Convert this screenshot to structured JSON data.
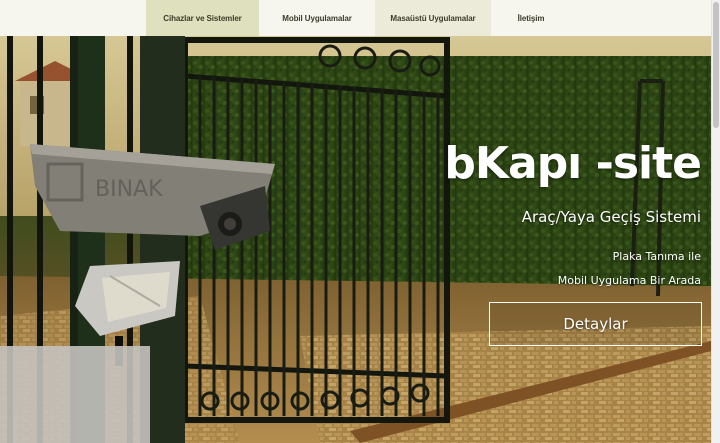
{
  "nav": {
    "items": [
      {
        "label": "Cihazlar ve Sistemler",
        "active": true
      },
      {
        "label": "Mobil Uygulamalar"
      },
      {
        "label": "Masaüstü Uygulamalar"
      },
      {
        "label": "İletişim"
      }
    ]
  },
  "hero": {
    "title": "bKapı -site",
    "subtitle": "Araç/Yaya Geçiş Sistemi",
    "line1": "Plaka Tanıma ile",
    "line2": "Mobil Uygulama Bir Arada",
    "button_label": "Detaylar",
    "camera_brand": "BINAK"
  },
  "colors": {
    "active_tab": "#dfe0bd",
    "hover_tab": "#ecebd9",
    "nav_bg": "#f7f6ee",
    "nav_text": "#3d3b2b"
  }
}
